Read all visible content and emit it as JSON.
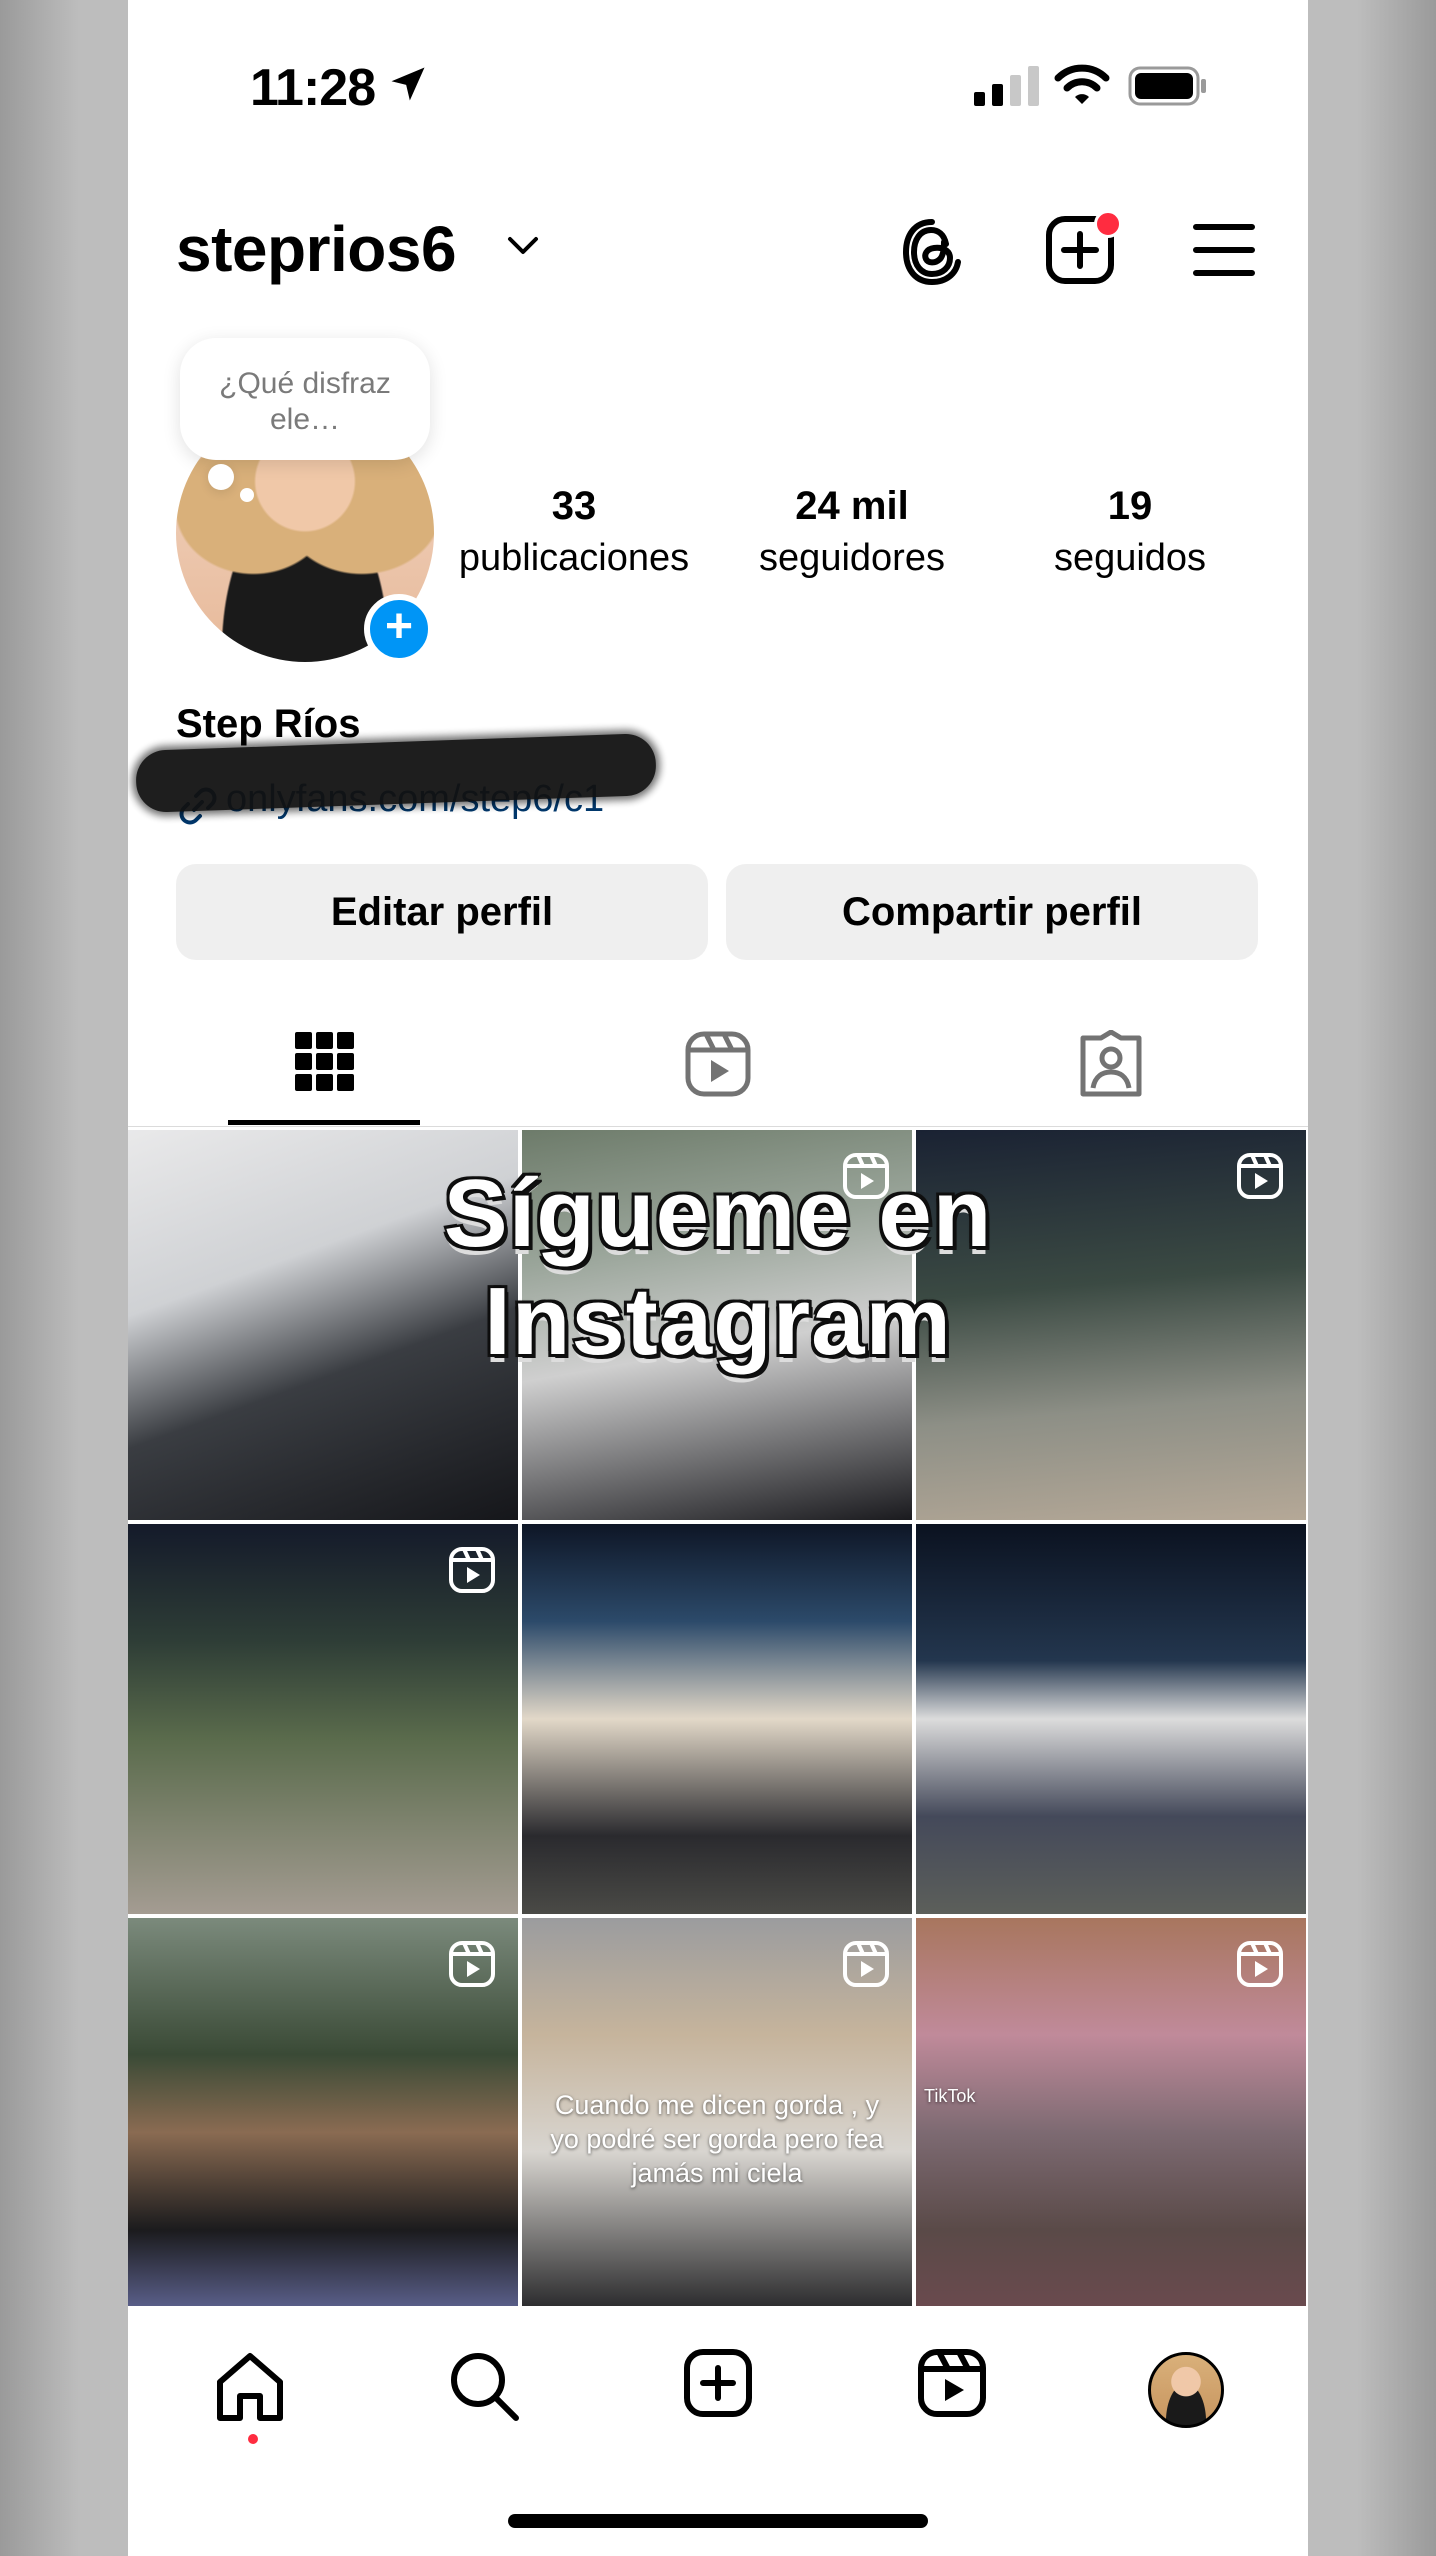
{
  "status_bar": {
    "time": "11:28"
  },
  "header": {
    "username": "steprios6"
  },
  "profile": {
    "note": "¿Qué disfraz ele…",
    "stats": [
      {
        "value": "33",
        "label": "publicaciones"
      },
      {
        "value": "24 mil",
        "label": "seguidores"
      },
      {
        "value": "19",
        "label": "seguidos"
      }
    ],
    "full_name": "Step Ríos",
    "link": "onlyfans.com/step6/c1"
  },
  "buttons": {
    "edit": "Editar perfil",
    "share": "Compartir perfil"
  },
  "overlay": {
    "line1": "Sígueme en",
    "line2": "Instagram"
  },
  "grid": {
    "posts": [
      {
        "reel": false
      },
      {
        "reel": true
      },
      {
        "reel": true
      },
      {
        "reel": true
      },
      {
        "reel": false
      },
      {
        "reel": false
      },
      {
        "reel": true
      },
      {
        "reel": true,
        "caption": "Cuando me dicen gorda , y yo podré ser gorda pero fea jamás mi ciela"
      },
      {
        "reel": true,
        "watermark": "TikTok"
      }
    ]
  },
  "colors": {
    "accent": "#0095f6",
    "link": "#00376b",
    "notification": "#ff2c40",
    "button_bg": "#efefef"
  },
  "icons": [
    "location-arrow-icon",
    "signal-icon",
    "wifi-icon",
    "battery-icon",
    "chevron-down-icon",
    "threads-icon",
    "new-post-icon",
    "menu-icon",
    "link-icon",
    "grid-icon",
    "reels-icon",
    "tagged-icon",
    "home-icon",
    "search-icon",
    "create-icon",
    "profile-avatar-icon"
  ]
}
